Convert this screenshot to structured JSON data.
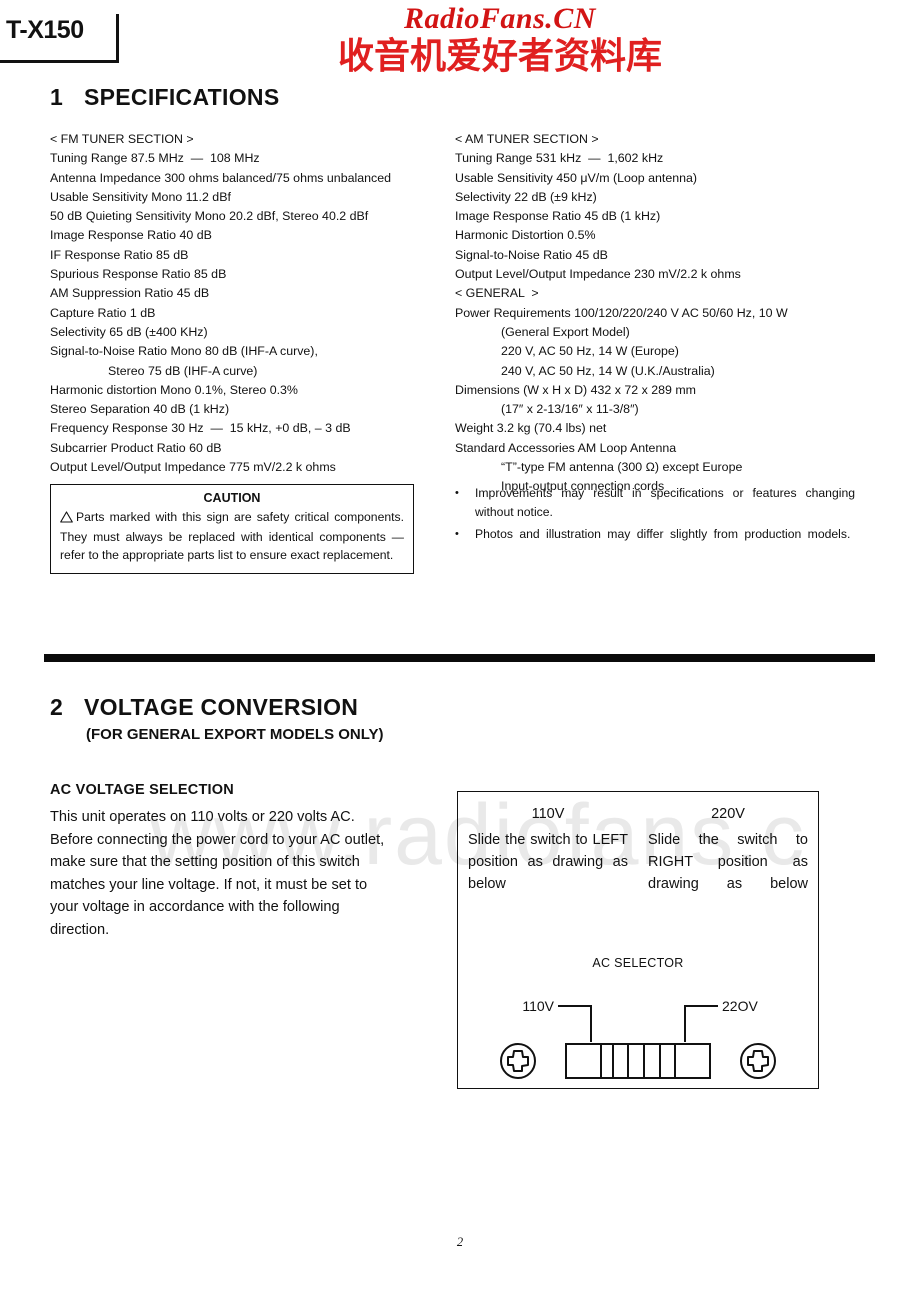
{
  "document": {
    "model": "T-X150",
    "page_number": "2"
  },
  "watermark": {
    "english": "RadioFans.CN",
    "chinese": "收音机爱好者资料库",
    "url_overlay": "www.radiofans.c",
    "red_color": "#e02020",
    "gray_color": "#e9e9e9"
  },
  "sections": {
    "specifications": {
      "number": "1",
      "title": "SPECIFICATIONS"
    },
    "voltage_conversion": {
      "number": "2",
      "title": "VOLTAGE CONVERSION",
      "subtitle": "(FOR GENERAL EXPORT MODELS ONLY)"
    }
  },
  "fm_tuner": {
    "heading": "< FM TUNER SECTION >",
    "lines": [
      "Tuning Range 87.5 MHz  —  108 MHz",
      "Antenna Impedance 300 ohms balanced/75 ohms unbalanced",
      "Usable Sensitivity Mono 11.2 dBf",
      "50 dB Quieting Sensitivity Mono 20.2 dBf, Stereo 40.2 dBf",
      "Image Response Ratio 40 dB",
      "IF Response Ratio 85 dB",
      "Spurious Response Ratio 85 dB",
      "AM Suppression Ratio 45 dB",
      "Capture Ratio 1 dB",
      "Selectivity 65 dB (±400 KHz)",
      "Signal-to-Noise Ratio Mono 80 dB (IHF-A curve),",
      "Stereo 75 dB (IHF-A curve)",
      "Harmonic distortion Mono 0.1%, Stereo 0.3%",
      "Stereo Separation 40 dB (1 kHz)",
      "Frequency Response 30 Hz  —  15 kHz, +0 dB, – 3 dB",
      "Subcarrier Product Ratio 60 dB",
      "Output Level/Output Impedance 775 mV/2.2 k ohms"
    ],
    "indented_line_indexes": [
      11
    ]
  },
  "am_tuner": {
    "heading": "< AM TUNER SECTION >",
    "lines": [
      "Tuning Range 531 kHz  —  1,602 kHz",
      "Usable Sensitivity 450 μV/m (Loop antenna)",
      "Selectivity 22 dB (±9 kHz)",
      "Image Response Ratio 45 dB (1 kHz)",
      "Harmonic Distortion 0.5%",
      "Signal-to-Noise Ratio 45 dB",
      "Output Level/Output Impedance 230 mV/2.2 k ohms"
    ]
  },
  "general": {
    "heading": "< GENERAL  >",
    "lines": [
      "Power Requirements 100/120/220/240 V AC 50/60 Hz, 10 W",
      "(General Export Model)",
      "220 V, AC 50 Hz, 14 W (Europe)",
      "240 V, AC 50 Hz, 14 W (U.K./Australia)",
      "Dimensions (W x H x D) 432 x 72 x 289 mm",
      "(17″ x 2-13/16″ x 11-3/8″)",
      "Weight 3.2 kg (70.4 lbs) net",
      "Standard Accessories AM Loop Antenna",
      "“T”-type FM antenna (300 Ω) except Europe",
      "Input-output connection cords"
    ],
    "indented_line_indexes": [
      1,
      2,
      3,
      5,
      8,
      9
    ]
  },
  "caution": {
    "title": "CAUTION",
    "icon": "warning-triangle-icon",
    "body": "Parts marked with this sign are safety critical components. They must always be replaced with identical components — refer to the appropriate parts list to ensure exact replacement."
  },
  "notes": {
    "bullet": "•",
    "items": [
      "Improvements may result in specifications or features changing without notice.",
      "Photos and illustration may differ slightly from production models."
    ]
  },
  "ac_voltage_selection": {
    "title": "AC VOLTAGE SELECTION",
    "body": "This unit operates on 110 volts or 220 volts AC. Before connecting the power cord to your AC outlet, make sure that the setting position of this switch matches your line voltage. If not, it must be set to your voltage in accordance with the following direction."
  },
  "voltage_diagram": {
    "columns": [
      {
        "voltage": "110V",
        "instruction": "Slide the switch to LEFT position as drawing as below"
      },
      {
        "voltage": "220V",
        "instruction": "Slide the switch to RIGHT position as drawing as below"
      }
    ],
    "selector_label": "AC SELECTOR",
    "left_terminal_label": "110V",
    "right_terminal_label": "22OV",
    "icons": {
      "left_screw": "phillips-screw-icon",
      "right_screw": "phillips-screw-icon",
      "slider": "slide-switch-icon"
    }
  }
}
